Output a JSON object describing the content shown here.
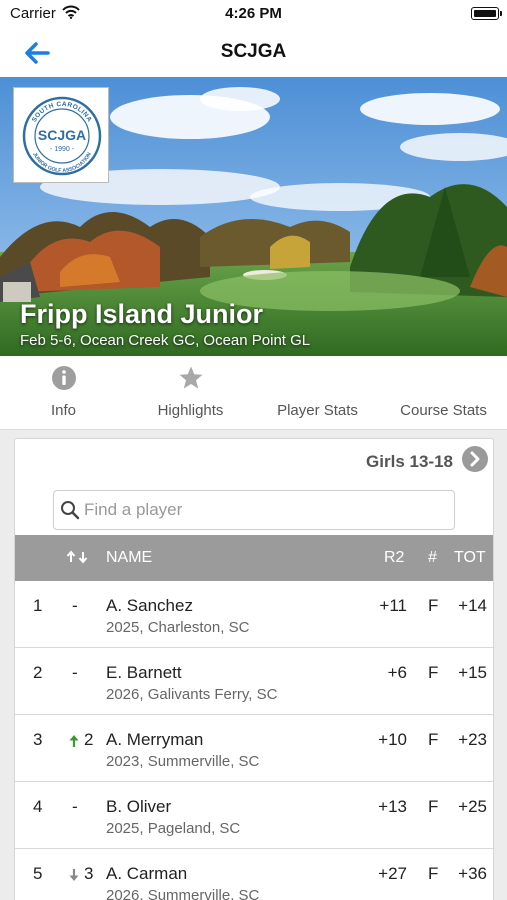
{
  "status_bar": {
    "carrier": "Carrier",
    "time": "4:26 PM"
  },
  "nav": {
    "title": "SCJGA"
  },
  "hero": {
    "event_title": "Fripp Island Junior",
    "event_subtitle": "Feb 5-6, Ocean Creek GC, Ocean Point GL",
    "logo": {
      "top_text": "SOUTH CAROLINA",
      "mark": "SCJGA",
      "year": "1990",
      "bottom_text": "JUNIOR GOLF ASSOCIATION"
    }
  },
  "tabs": [
    {
      "label": "Info",
      "icon": "info-icon"
    },
    {
      "label": "Highlights",
      "icon": "star-icon"
    },
    {
      "label": "Player Stats",
      "icon": "none"
    },
    {
      "label": "Course Stats",
      "icon": "none"
    }
  ],
  "division": {
    "label": "Girls 13-18"
  },
  "search": {
    "placeholder": "Find a player"
  },
  "table": {
    "headers": {
      "name": "NAME",
      "r2": "R2",
      "hole": "#",
      "tot": "TOT"
    },
    "rows": [
      {
        "pos": "1",
        "move_dir": "none",
        "move": "-",
        "name": "A. Sanchez",
        "info": "2025, Charleston, SC",
        "r2": "+11",
        "hole": "F",
        "tot": "+14"
      },
      {
        "pos": "2",
        "move_dir": "none",
        "move": "-",
        "name": "E. Barnett",
        "info": "2026, Galivants Ferry, SC",
        "r2": "+6",
        "hole": "F",
        "tot": "+15"
      },
      {
        "pos": "3",
        "move_dir": "up",
        "move": "2",
        "name": "A. Merryman",
        "info": "2023, Summerville, SC",
        "r2": "+10",
        "hole": "F",
        "tot": "+23"
      },
      {
        "pos": "4",
        "move_dir": "none",
        "move": "-",
        "name": "B. Oliver",
        "info": "2025, Pageland, SC",
        "r2": "+13",
        "hole": "F",
        "tot": "+25"
      },
      {
        "pos": "5",
        "move_dir": "down",
        "move": "3",
        "name": "A. Carman",
        "info": "2026, Summerville, SC",
        "r2": "+27",
        "hole": "F",
        "tot": "+36"
      }
    ]
  },
  "colors": {
    "accent": "#1a7fe0",
    "header_gray": "#9b9b9b",
    "up_arrow": "#3a9b2a",
    "down_arrow": "#888888"
  }
}
